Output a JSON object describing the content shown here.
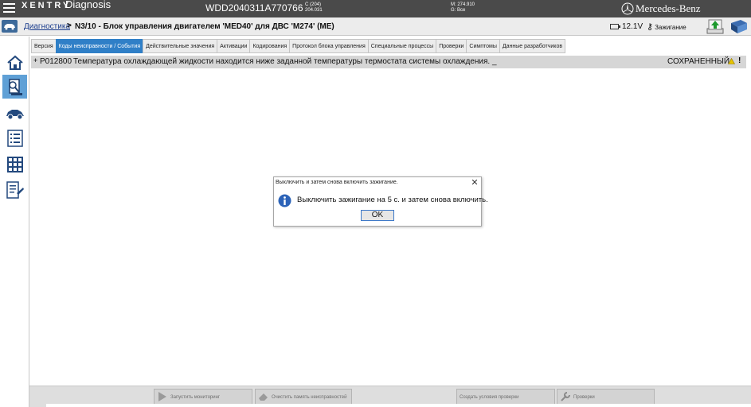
{
  "header": {
    "brand": "XENTRY",
    "app_name": "Diagnosis",
    "vin": "WDD2040311A770766",
    "model_line1": "C (204)",
    "model_line2": "204.031",
    "mileage_line1": "M: 274.910",
    "mileage_line2": "G: Все",
    "manufacturer": "Mercedes-Benz",
    "accent_color": "#4a4a4a"
  },
  "breadcrumb": {
    "link": "Диагностика",
    "separator": ">",
    "title": "N3/10 - Блок управления двигателем 'MED40' для ДВС 'M274' (ME)"
  },
  "status": {
    "battery": "12.1V",
    "ignition": "Зажигание"
  },
  "sidebar": {
    "items": [
      {
        "icon": "home-icon"
      },
      {
        "icon": "ecu-diagnosis-icon",
        "active": true
      },
      {
        "icon": "vehicle-icon"
      },
      {
        "icon": "list-icon"
      },
      {
        "icon": "grid-icon"
      },
      {
        "icon": "document-tool-icon"
      }
    ]
  },
  "tabs": [
    {
      "label": "Версия"
    },
    {
      "label": "Коды неисправности / События",
      "active": true
    },
    {
      "label": "Действительные значения"
    },
    {
      "label": "Активации"
    },
    {
      "label": "Кодирования"
    },
    {
      "label": "Протокол блока управления"
    },
    {
      "label": "Специальные процессы"
    },
    {
      "label": "Проверки"
    },
    {
      "label": "Симптомы"
    },
    {
      "label": "Данные разработчиков"
    }
  ],
  "fault": {
    "expander": "+",
    "code": "P012800",
    "description": "Температура охлаждающей жидкости находится ниже заданной температуры термостата системы охлаждения. _",
    "status": "СОХРАНЕННЫЙ",
    "more": "!"
  },
  "dialog": {
    "title": "Выключить и затем снова включить зажигание.",
    "message": "Выключить зажигание на 5 с. и затем снова включить.",
    "ok_label": "OK",
    "close_glyph": "✕"
  },
  "bottom_toolbar": {
    "start_monitoring": "Запустить мониторинг",
    "clear_faults": "Очистить память неисправностей",
    "create_conditions": "Создать условия проверки",
    "checks": "Проверки"
  },
  "colors": {
    "tab_active": "#2f7fc7",
    "sidebar_active": "#5fa0d6",
    "link": "#1a3c8c"
  }
}
